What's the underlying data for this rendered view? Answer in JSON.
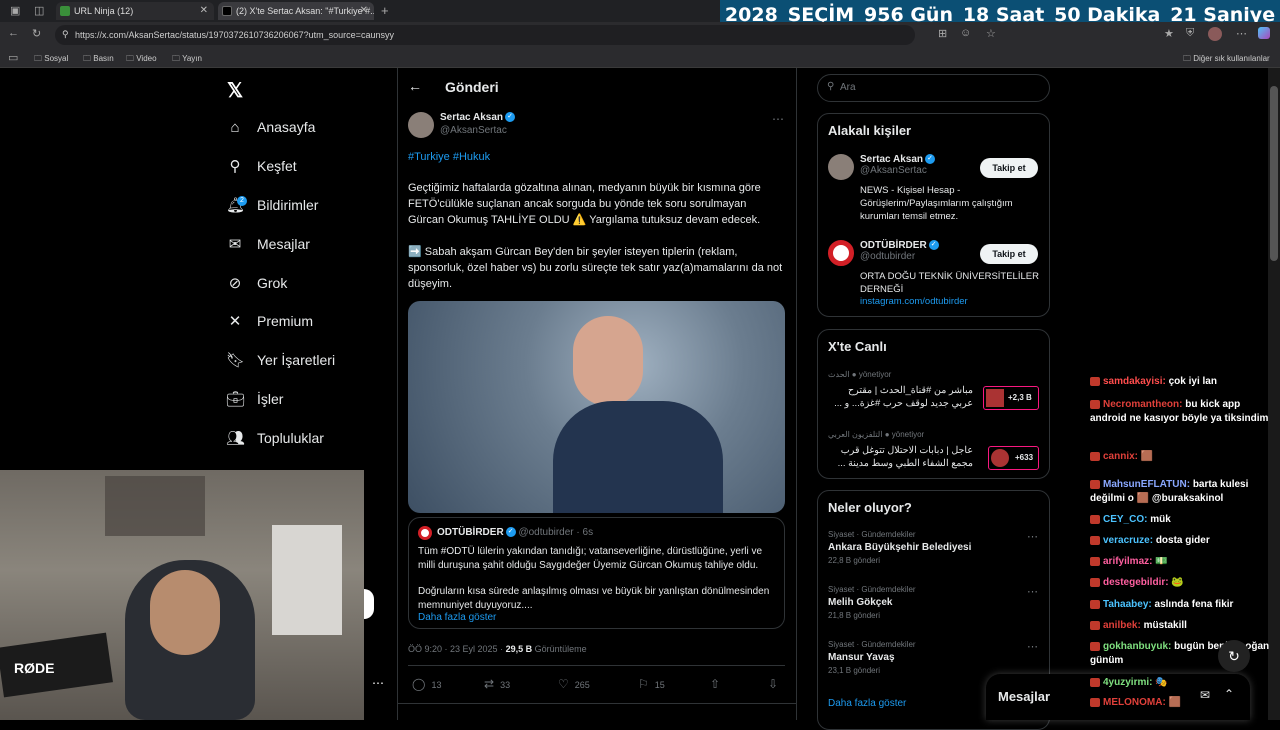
{
  "browser": {
    "tabs": [
      {
        "label": "URL Ninja (12)"
      },
      {
        "label": "(2) X'te Sertac Aksan: \"#Turkiye #..."
      }
    ],
    "url": "https://x.com/AksanSertac/status/1970372610736206067?utm_source=caunsyy",
    "bookmarks": [
      "Sosyal",
      "Basın",
      "Video",
      "Yayın"
    ],
    "other_bookmarks": "Diğer sık kullanılanlar"
  },
  "countdown": {
    "year_label": "2028",
    "election": "SEÇİM",
    "days": "956 Gün",
    "hours": "18 Saat",
    "minutes": "50 Dakika",
    "seconds": "21 Saniye"
  },
  "nav": {
    "items": [
      {
        "label": "Anasayfa",
        "icon": "home-icon"
      },
      {
        "label": "Keşfet",
        "icon": "search-icon"
      },
      {
        "label": "Bildirimler",
        "icon": "bell-icon",
        "badge": "2"
      },
      {
        "label": "Mesajlar",
        "icon": "mail-icon"
      },
      {
        "label": "Grok",
        "icon": "grok-icon"
      },
      {
        "label": "Premium",
        "icon": "x-icon"
      },
      {
        "label": "Yer İşaretleri",
        "icon": "bookmark-icon"
      },
      {
        "label": "İşler",
        "icon": "briefcase-icon"
      },
      {
        "label": "Topluluklar",
        "icon": "people-icon"
      }
    ]
  },
  "post": {
    "header": "Gönderi",
    "author_name": "Sertac Aksan",
    "author_handle": "@AksanSertac",
    "hashtags": "#Turkiye #Hukuk",
    "paragraph1": "Geçtiğimiz haftalarda gözaltına alınan, medyanın büyük bir kısmına göre FETÖ'cülükle suçlanan ancak sorguda bu yönde tek soru sorulmayan Gürcan Okumuş TAHLİYE OLDU ⚠️ Yargılama tutuksuz devam edecek.",
    "paragraph2": "➡️ Sabah akşam Gürcan Bey'den bir şeyler isteyen tiplerin (reklam, sponsorluk, özel haber vs) bu zorlu süreçte tek satır yaz(a)mamalarını da not düşeyim.",
    "quote": {
      "name": "ODTÜBİRDER",
      "handle": "@odtubirder · 6s",
      "text1": "Tüm #ODTÜ lülerin yakından tanıdığı; vatanseverliğine, dürüstlüğüne, yerli ve milli duruşuna şahit olduğu Saygıdeğer Üyemiz Gürcan Okumuş tahliye oldu.",
      "text2": "Doğruların kısa sürede anlaşılmış olması ve büyük bir yanlıştan dönülmesinden memnuniyet duyuyoruz....",
      "more": "Daha fazla göster"
    },
    "time": "ÖÖ 9:20 · 23 Eyl 2025 ·",
    "views_count": "29,5 B",
    "views_label": "Görüntüleme",
    "actions": {
      "reply": "13",
      "repost": "33",
      "like": "265",
      "bookmark": "15"
    }
  },
  "search": {
    "placeholder": "Ara"
  },
  "related": {
    "title": "Alakalı kişiler",
    "follow_label": "Takip et",
    "people": [
      {
        "name": "Sertac Aksan",
        "handle": "@AksanSertac",
        "bio": "NEWS - Kişisel Hesap - Görüşlerim/Paylaşımlarım çalıştığım kurumları temsil etmez."
      },
      {
        "name": "ODTÜBİRDER",
        "handle": "@odtubirder",
        "bio": "ORTA DOĞU TEKNİK ÜNİVERSİTELİLER DERNEĞİ",
        "link": "instagram.com/odtubirder"
      }
    ]
  },
  "live": {
    "title": "X'te Canlı",
    "items": [
      {
        "channel": "الحدث",
        "status": "yönetiyor",
        "text": "مباشر من #قناة_الحدث | مقترح عربي جديد لوقف حرب #غزة... و ...",
        "count": "+2,3 B"
      },
      {
        "channel": "التلفزيون العربي",
        "status": "yönetiyor",
        "text": "عاجل | دبابات الاحتلال تتوغل قرب مجمع الشفاء الطبي وسط مدينة ...",
        "count": "+633"
      }
    ]
  },
  "trends": {
    "title": "Neler oluyor?",
    "items": [
      {
        "category": "Siyaset · Gündemdekiler",
        "name": "Ankara Büyükşehir Belediyesi",
        "posts": "22,8 B gönderi"
      },
      {
        "category": "Siyaset · Gündemdekiler",
        "name": "Melih Gökçek",
        "posts": "21,8 B gönderi"
      },
      {
        "category": "Siyaset · Gündemdekiler",
        "name": "Mansur Yavaş",
        "posts": "23,1 B gönderi"
      }
    ],
    "more": "Daha fazla göster"
  },
  "messages_bar": {
    "label": "Mesajlar"
  },
  "chat": [
    {
      "user": "samdakayisi:",
      "msg": "çok iyi lan",
      "color": "#ff4d4d"
    },
    {
      "user": "Necromantheon:",
      "msg": "bu kick app android ne kasıyor böyle ya tiksindim",
      "color": "#e0403a"
    },
    {
      "user": "cannix:",
      "msg": "🟫",
      "color": "#e0403a"
    },
    {
      "user": "MahsunEFLATUN:",
      "msg": "barta kulesi değilmi o 🟫 @buraksakinol",
      "color": "#8aa8ff"
    },
    {
      "user": "CEY_CO:",
      "msg": "mük",
      "color": "#4cc3ff"
    },
    {
      "user": "veracruze:",
      "msg": "dosta gider",
      "color": "#4cc3ff"
    },
    {
      "user": "arifyilmaz:",
      "msg": "💵",
      "color": "#ff5fa0"
    },
    {
      "user": "destegebildir:",
      "msg": "🐸",
      "color": "#ff5fa0"
    },
    {
      "user": "Tahaabey:",
      "msg": "aslında fena fikir",
      "color": "#4cc3ff"
    },
    {
      "user": "anilbek:",
      "msg": "müstakill",
      "color": "#e0403a"
    },
    {
      "user": "gokhanbuyuk:",
      "msg": "bugün benim soğan günüm",
      "color": "#7fe07f"
    },
    {
      "user": "4yuzyirmi:",
      "msg": "🎭",
      "color": "#7fe07f"
    },
    {
      "user": "MELONOMA:",
      "msg": "🟫",
      "color": "#e0403a"
    }
  ]
}
